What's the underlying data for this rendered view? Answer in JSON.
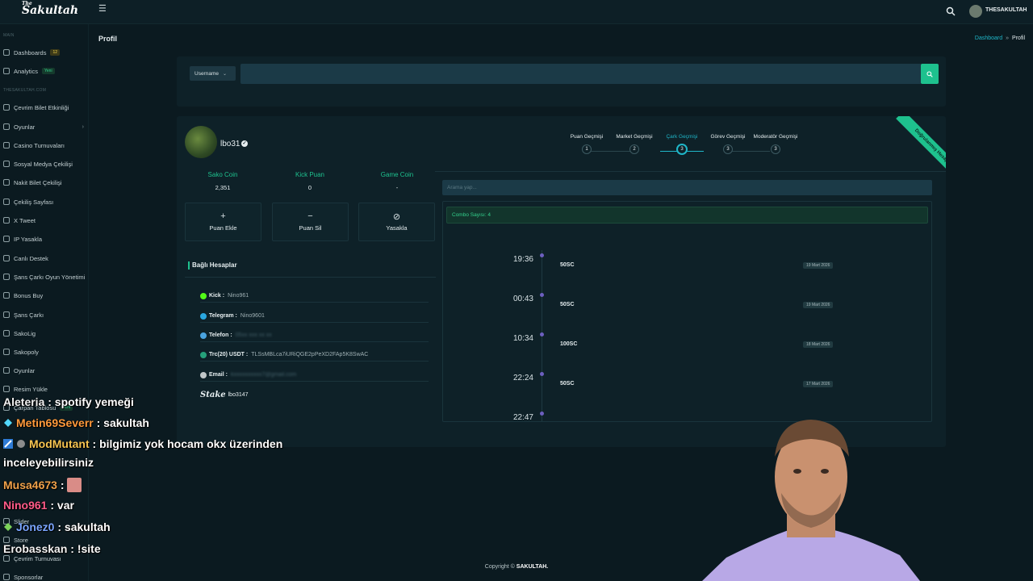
{
  "topbar": {
    "logo_small": "The",
    "logo": "Sakultah",
    "username": "THESAKULTAH"
  },
  "sidebar": {
    "section_main": "MAIN",
    "section_site": "THESAKULTAH.COM",
    "items": [
      {
        "label": "Dashboards",
        "badge": "12"
      },
      {
        "label": "Analytics",
        "badge": "Yeni"
      },
      {
        "label": "Çevrim Bilet Etkinliği"
      },
      {
        "label": "Oyunlar"
      },
      {
        "label": "Casino Turnuvaları"
      },
      {
        "label": "Sosyal Medya Çekilişi"
      },
      {
        "label": "Nakit Bilet Çekilişi"
      },
      {
        "label": "Çekiliş Sayfası"
      },
      {
        "label": "X Tweet"
      },
      {
        "label": "IP Yasakla"
      },
      {
        "label": "Canlı Destek"
      },
      {
        "label": "Şans Çarkı Oyun Yönetimi"
      },
      {
        "label": "Bonus Buy"
      },
      {
        "label": "Şans Çarkı"
      },
      {
        "label": "SakoLig"
      },
      {
        "label": "Sakopoly"
      },
      {
        "label": "Oyunlar"
      },
      {
        "label": "Resim Yükle"
      },
      {
        "label": "Çarpan Tablosu",
        "badge": "Yeni"
      },
      {
        "label": "Slider"
      },
      {
        "label": "Store"
      },
      {
        "label": "Çevrim Turnuvası"
      },
      {
        "label": "Sponsorlar"
      }
    ]
  },
  "page": {
    "title": "Profil",
    "breadcrumb_link": "Dashboard",
    "breadcrumb_sep": "»",
    "breadcrumb_current": "Profil"
  },
  "search": {
    "select_value": "Username",
    "input_value": ""
  },
  "profile": {
    "ribbon": "Doğrulanmış Hesap",
    "name": "lbo31",
    "stats": [
      {
        "label": "Sako Coin",
        "value": "2,351"
      },
      {
        "label": "Kick Puan",
        "value": "0"
      },
      {
        "label": "Game Coin",
        "value": "-"
      }
    ],
    "actions": [
      {
        "icon": "+",
        "label": "Puan Ekle"
      },
      {
        "icon": "−",
        "label": "Puan Sil"
      },
      {
        "icon": "⊘",
        "label": "Yasakla"
      }
    ],
    "linked_title": "Bağlı Hesaplar",
    "accounts": [
      {
        "key": "Kick :",
        "value": "Nino961",
        "color": "#53fc18"
      },
      {
        "key": "Telegram :",
        "value": "Nino9601",
        "color": "#2aa7e0"
      },
      {
        "key": "Telefon :",
        "value": "05xx xxx xx xx",
        "color": "#4aa3df"
      },
      {
        "key": "Trc(20) USDT :",
        "value": "TLSsMBLca7iURiQGE2pPeXD2FAp5K8SwAC",
        "color": "#26a17b"
      },
      {
        "key": "Email :",
        "value": "kxxxxxxxxxx7@gmail.com",
        "color": "#c0c6c8"
      },
      {
        "key": "",
        "value": "lbo3147",
        "logo": "Stake"
      }
    ]
  },
  "tabs": [
    {
      "label": "Puan Geçmişi",
      "num": "1"
    },
    {
      "label": "Market Geçmişi",
      "num": "2"
    },
    {
      "label": "Çark Geçmişi",
      "num": "3"
    },
    {
      "label": "Görev Geçmişi",
      "num": "3"
    },
    {
      "label": "Moderatör Geçmişi",
      "num": "3"
    }
  ],
  "history": {
    "search_placeholder": "Arama yap...",
    "combo": "Combo Sayısı: 4",
    "entries": [
      {
        "time": "19:36",
        "amount": "50SC",
        "date": "19 Mart 2026"
      },
      {
        "time": "00:43",
        "amount": "50SC",
        "date": "19 Mart 2026"
      },
      {
        "time": "10:34",
        "amount": "100SC",
        "date": "18 Mart 2026"
      },
      {
        "time": "22:24",
        "amount": "50SC",
        "date": "17 Mart 2026"
      },
      {
        "time": "22:47",
        "amount": "",
        "date": ""
      }
    ]
  },
  "footer": {
    "prefix": "Copyright ©",
    "brand": "SAKULTAH."
  },
  "chat": [
    {
      "user": "Aleteria",
      "msg": " : spotify yemeği"
    },
    {
      "user": "Metin69Severr",
      "msg": " : sakultah"
    },
    {
      "user": "ModMutant",
      "msg": " : bilgimiz yok hocam okx üzerinden"
    },
    {
      "user": "",
      "msg": "inceleyebilirsiniz"
    },
    {
      "user": "Musa4673",
      "msg": " : "
    },
    {
      "user": "Nino961",
      "msg": " : var"
    },
    {
      "user": "Jonez0",
      "msg": " : sakultah"
    },
    {
      "user": "Erobasskan",
      "msg": " : !site"
    }
  ]
}
